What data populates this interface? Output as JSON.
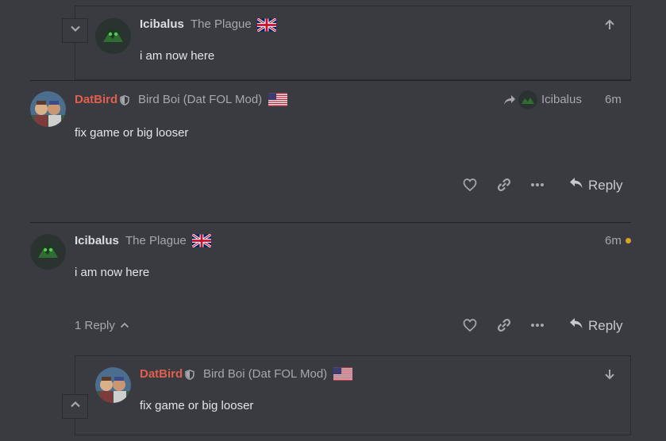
{
  "colors": {
    "background": "#393b40",
    "username_mod": "#e25f4f",
    "text_muted": "#a6a8ab",
    "unread_dot": "#d9a320"
  },
  "icons": {
    "collapse_up": "chevron-up-icon",
    "collapse_down": "chevron-down-icon",
    "scroll_up": "arrow-up-icon",
    "scroll_down": "arrow-down-icon",
    "shield": "shield-icon",
    "reply_to": "share-arrow-icon",
    "like": "heart-icon",
    "link": "link-icon",
    "more": "ellipsis-icon",
    "reply": "reply-icon",
    "flag_uk": "uk-flag-icon",
    "flag_us": "us-flag-icon"
  },
  "posts": [
    {
      "username": "Icibalus",
      "title": "The Plague",
      "body": "i am now here"
    },
    {
      "username": "DatBird",
      "title": "Bird Boi (Dat FOL Mod)",
      "reply_to": "Icibalus",
      "time": "6m",
      "body": "fix game or big looser",
      "reply_label": "Reply"
    },
    {
      "username": "Icibalus",
      "title": "The Plague",
      "time": "6m",
      "body": "i am now here",
      "replies_label": "1 Reply",
      "reply_label": "Reply"
    },
    {
      "username": "DatBird",
      "title": "Bird Boi (Dat FOL Mod)",
      "body": "fix game or big looser"
    }
  ]
}
